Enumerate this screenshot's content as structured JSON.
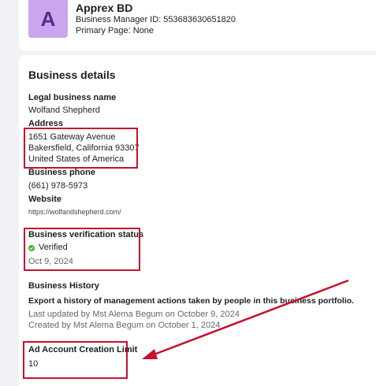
{
  "header": {
    "avatar_letter": "A",
    "business_name": "Apprex BD",
    "business_manager_id": "Business Manager ID: 553683630651820",
    "primary_page": "Primary Page: None"
  },
  "details": {
    "title": "Business details",
    "legal_name_label": "Legal business name",
    "legal_name_value": "Wolfand Shepherd",
    "address_label": "Address",
    "address_line1": "1651 Gateway Avenue",
    "address_line2": "Bakersfield, California 93307",
    "address_line3": "United States of America",
    "phone_label": "Business phone",
    "phone_value": "(661) 978-5973",
    "website_label": "Website",
    "website_value": "https://wolfandshepherd.com/",
    "verification_label": "Business verification status",
    "verification_status": "Verified",
    "verification_date": "Oct 9, 2024",
    "history_label": "Business History",
    "history_export": "Export a history of management actions taken by people in this business portfolio.",
    "history_updated": "Last updated by Mst Alema Begum on October 9, 2024",
    "history_created": "Created by Mst Alema Begum on October 1, 2024",
    "ad_limit_label": "Ad Account Creation Limit",
    "ad_limit_value": "10"
  },
  "colors": {
    "annotation": "#c8102e",
    "verified": "#42b72a",
    "avatar_bg": "#c9a6ee"
  }
}
